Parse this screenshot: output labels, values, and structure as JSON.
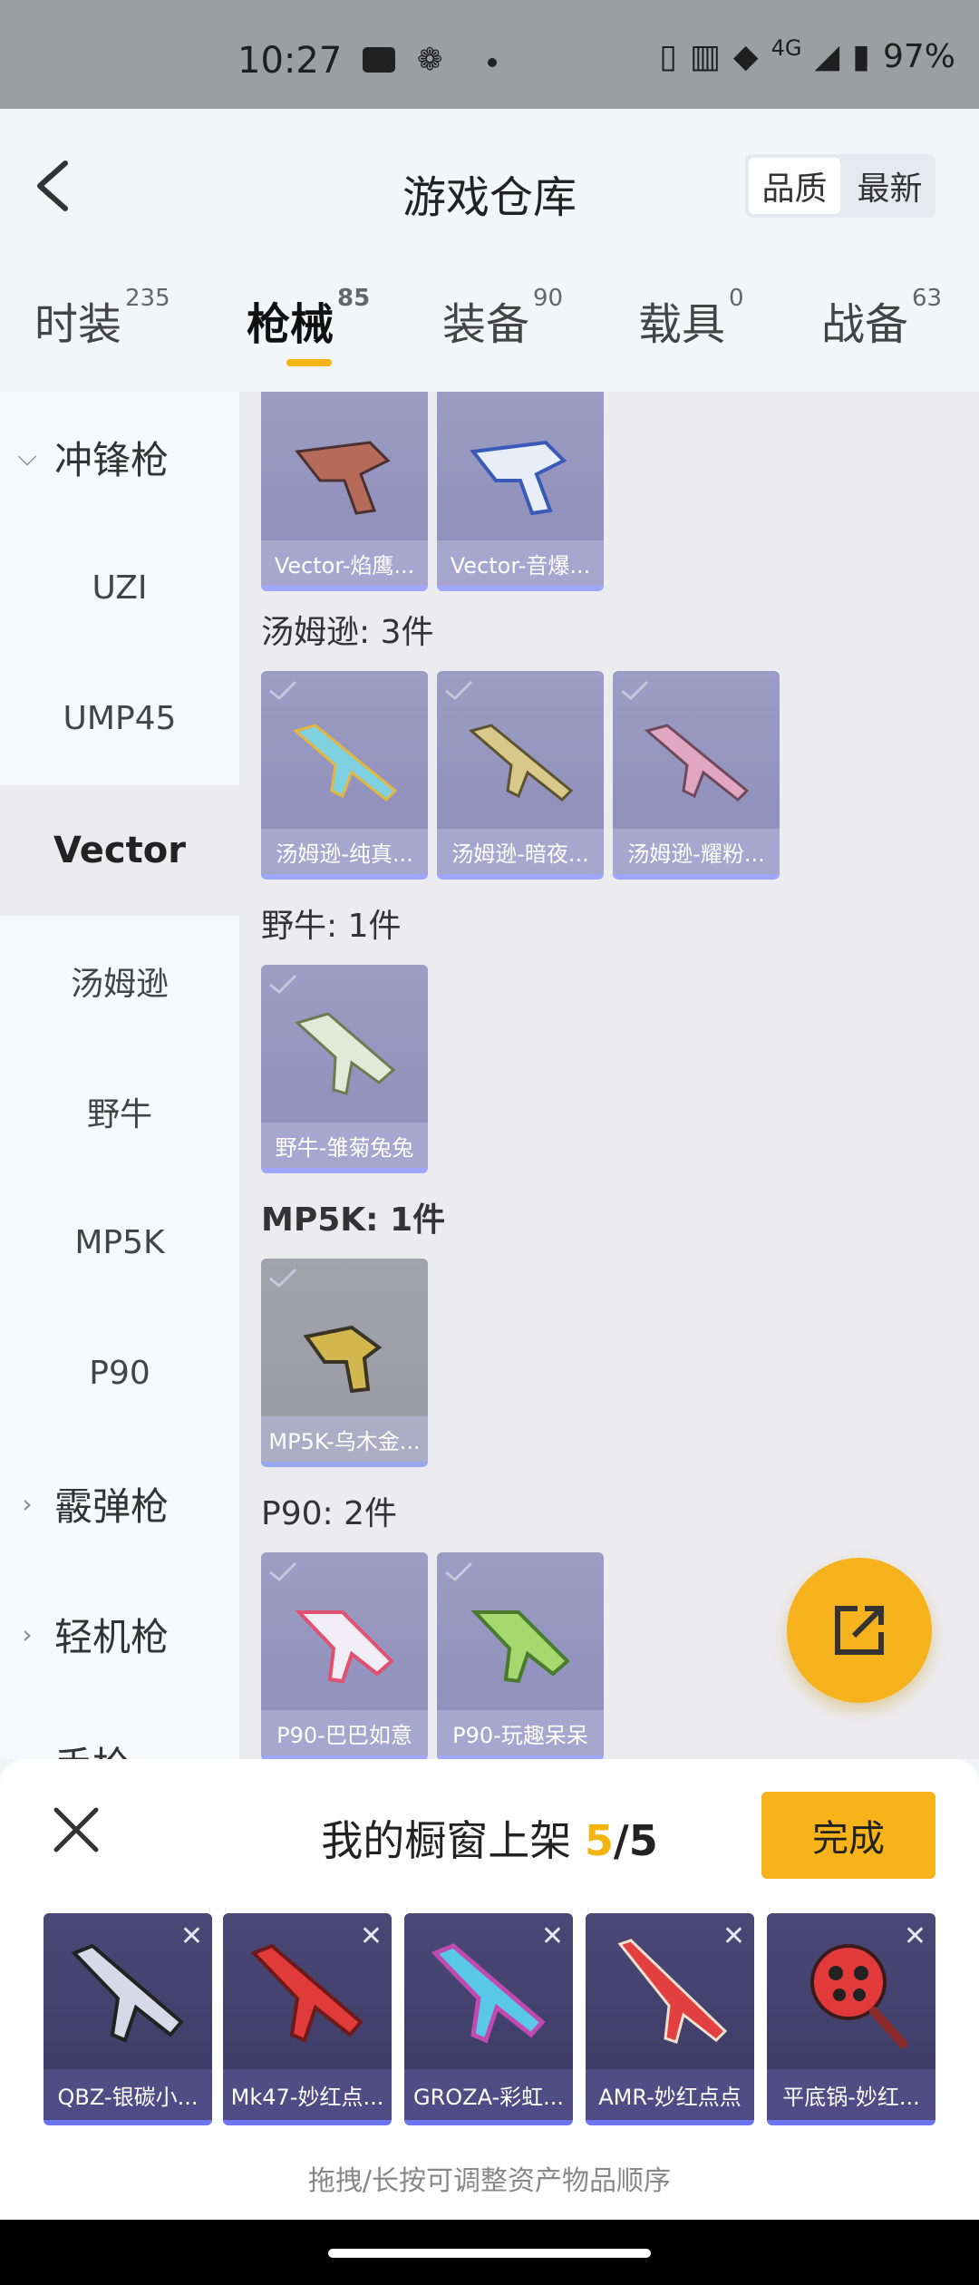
{
  "status": {
    "time": "10:27",
    "network": "4G",
    "battery": "97%"
  },
  "header": {
    "title": "游戏仓库",
    "sort_options": [
      "品质",
      "最新"
    ],
    "active_sort": "品质"
  },
  "tabs": [
    {
      "label": "时装",
      "count": "235"
    },
    {
      "label": "枪械",
      "count": "85",
      "active": true
    },
    {
      "label": "装备",
      "count": "90"
    },
    {
      "label": "载具",
      "count": "0"
    },
    {
      "label": "战备",
      "count": "63"
    }
  ],
  "sidebar": {
    "group_open": "冲锋枪",
    "items": [
      "UZI",
      "UMP45",
      "Vector",
      "汤姆逊",
      "野牛",
      "MP5K",
      "P90"
    ],
    "selected": "Vector",
    "groups_closed": [
      "霰弹枪",
      "轻机枪",
      "手枪"
    ]
  },
  "content": {
    "vector_items": [
      "Vector-焰鹰...",
      "Vector-音爆..."
    ],
    "groups": [
      {
        "title": "汤姆逊: 3件",
        "items": [
          "汤姆逊-纯真...",
          "汤姆逊-暗夜...",
          "汤姆逊-耀粉..."
        ]
      },
      {
        "title": "野牛: 1件",
        "items": [
          "野牛-雏菊兔兔"
        ]
      },
      {
        "title": "MP5K: 1件",
        "items": [
          "MP5K-乌木金..."
        ]
      },
      {
        "title": "P90: 2件",
        "items": [
          "P90-巴巴如意",
          "P90-玩趣呆呆"
        ]
      }
    ]
  },
  "sheet": {
    "title": "我的橱窗上架",
    "count": "5",
    "total": "/5",
    "done_label": "完成",
    "items": [
      "QBZ-银碳小...",
      "Mk47-妙红点...",
      "GROZA-彩虹...",
      "AMR-妙红点点",
      "平底锅-妙红..."
    ],
    "hint": "拖拽/长按可调整资产物品顺序"
  },
  "colors": {
    "accent": "#f6b21c",
    "card_purple": "#9192bf",
    "showcase_bg": "#3f3e68"
  }
}
